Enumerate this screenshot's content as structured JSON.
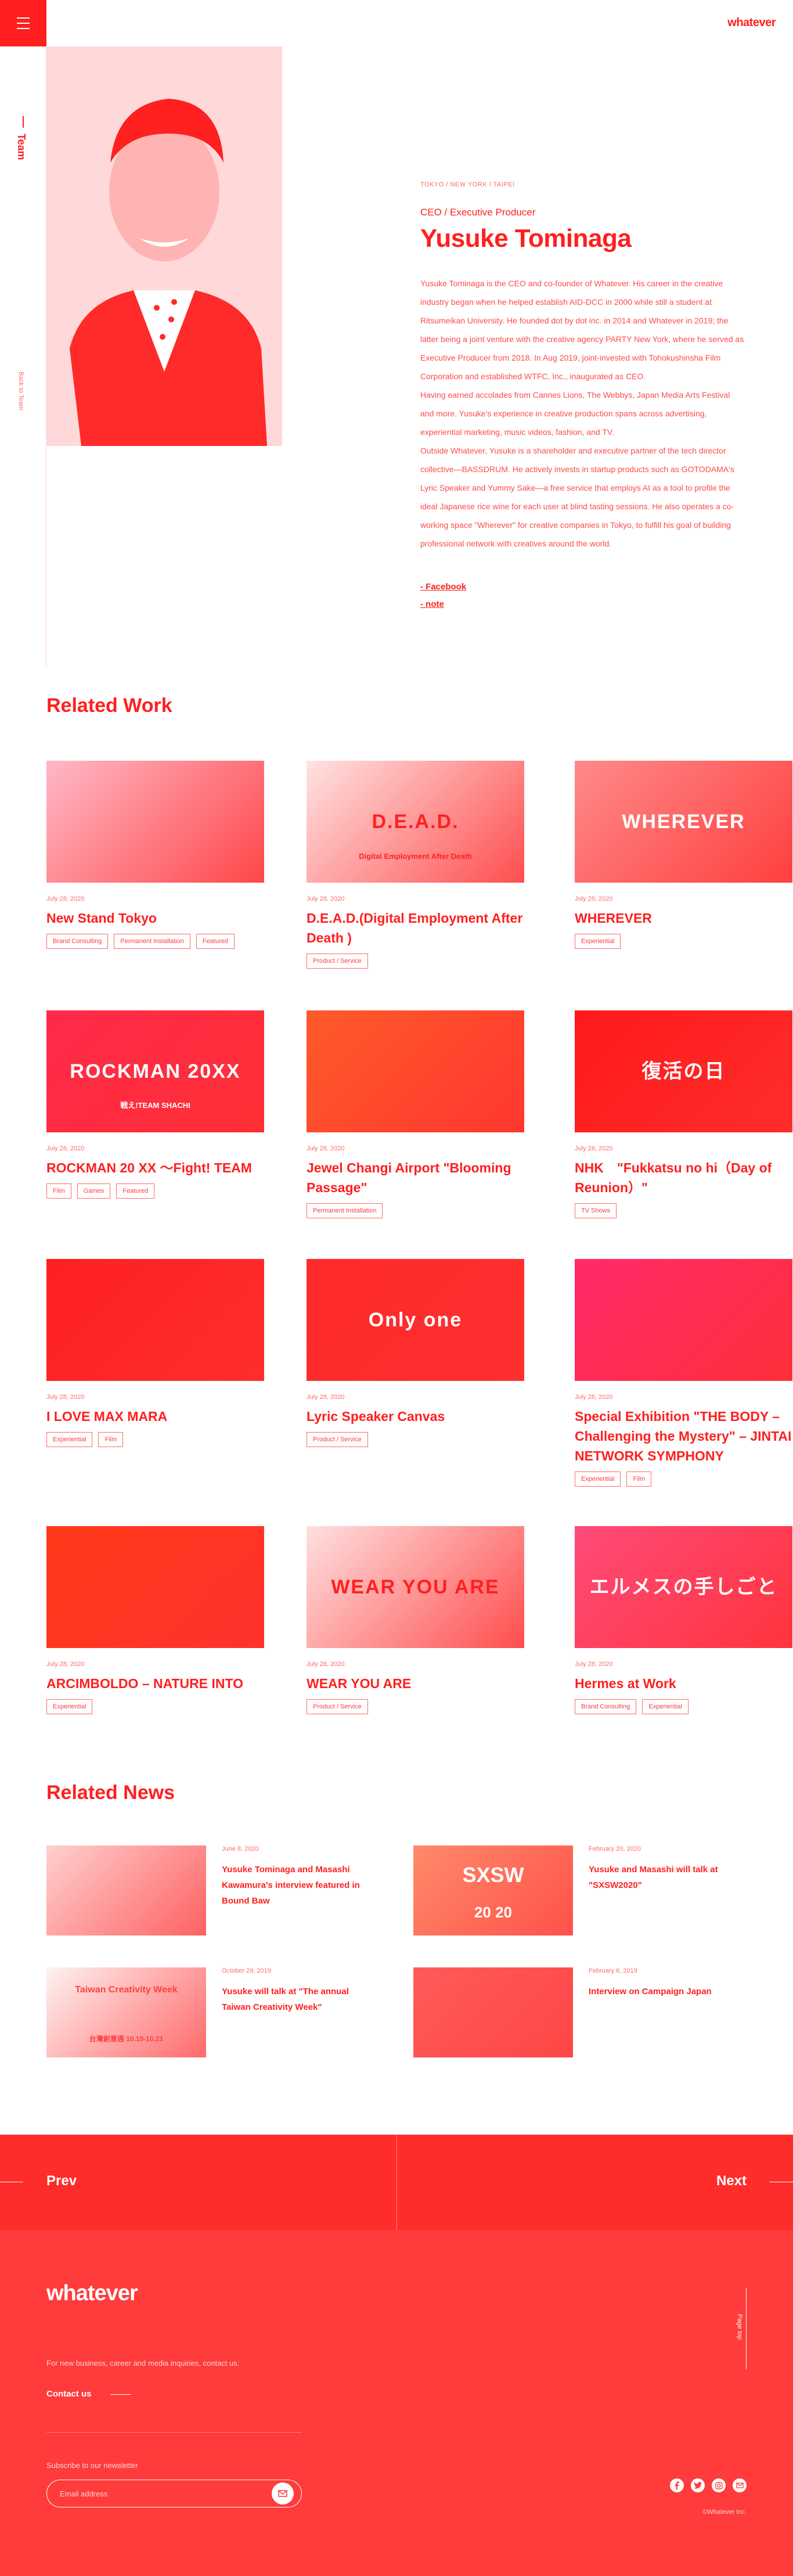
{
  "header": {
    "logo": "whatever",
    "menu_icon": "hamburger-icon"
  },
  "sidebar": {
    "label": "Team",
    "back_label": "Back to Team"
  },
  "profile": {
    "location": "TOKYO / NEW YORK / TAIPEI",
    "role": "CEO / Executive Producer",
    "name": "Yusuke Tominaga",
    "bio": [
      "Yusuke Tominaga is the CEO and co-founder of Whatever. His career in the creative industry began when he helped establish AID-DCC in 2000 while still a student at Ritsumeikan University. He founded dot by dot inc. in 2014 and Whatever in 2019; the latter being a joint venture with the creative agency PARTY New York, where he served as Executive Producer from 2018. In Aug 2019, joint-invested with Tohokushinsha Film Corporation and established WTFC, Inc., inaugurated as CEO.",
      "Having earned accolades from Cannes Lions, The Webbys, Japan Media Arts Festival and more. Yusuke's experience in creative production spans across advertising, experiential marketing, music videos, fashion, and TV.",
      "Outside Whatever, Yusuke is a shareholder and executive partner of the tech director collective—BASSDRUM. He actively invests in startup products such as GOTODAMA's Lyric Speaker and Yummy Sake—a free service that employs AI as a tool to profile the ideal Japanese rice wine for each user at blind tasting sessions. He also operates a co-working space \"Wherever\" for creative companies in Tokyo, to fulfill his goal of building professional network with creatives around the world."
    ],
    "links": [
      "- Facebook",
      "- note"
    ]
  },
  "related_work": {
    "heading": "Related Work",
    "items": [
      {
        "date": "July 28, 2020",
        "title": "New Stand Tokyo",
        "tags": [
          "Brand Consulting",
          "Permanent Installation",
          "Featured"
        ],
        "art": "",
        "color": "#ffb8c6"
      },
      {
        "date": "July 28, 2020",
        "title": "D.E.A.D.(Digital Employment After Death )",
        "tags": [
          "Product / Service"
        ],
        "art": "D.E.A.D.",
        "art_sub": "Digital Employment After Death",
        "color": "#ffe3e3"
      },
      {
        "date": "July 28, 2020",
        "title": "WHEREVER",
        "tags": [
          "Experiential"
        ],
        "art": "WHEREVER",
        "color": "#ff8a8a"
      },
      {
        "date": "July 28, 2020",
        "title": "ROCKMAN 20 XX 〜Fight! TEAM",
        "tags": [
          "Film",
          "Games",
          "Featured"
        ],
        "art": "ROCKMAN 20XX",
        "art_sub": "戦え!TEAM SHACHI",
        "color": "#ff2a4a"
      },
      {
        "date": "July 28, 2020",
        "title": "Jewel Changi Airport \"Blooming Passage\"",
        "tags": [
          "Permanent Installation"
        ],
        "art": "",
        "color": "#ff5a2a"
      },
      {
        "date": "July 28, 2020",
        "title": "NHK　\"Fukkatsu no hi（Day of Reunion）\"",
        "tags": [
          "TV Shows"
        ],
        "art": "復活の日",
        "color": "#ff1a1a"
      },
      {
        "date": "July 28, 2020",
        "title": "I LOVE MAX MARA",
        "tags": [
          "Experiential",
          "Film"
        ],
        "art": "",
        "color": "#ff2020"
      },
      {
        "date": "July 28, 2020",
        "title": "Lyric Speaker Canvas",
        "tags": [
          "Product / Service"
        ],
        "art": "Only one",
        "color": "#ff2a2a"
      },
      {
        "date": "July 28, 2020",
        "title": "Special Exhibition \"THE BODY – Challenging the Mystery\" – JINTAI NETWORK SYMPHONY",
        "tags": [
          "Experiential",
          "Film"
        ],
        "art": "",
        "color": "#ff2a6a"
      },
      {
        "date": "July 28, 2020",
        "title": "ARCIMBOLDO – NATURE INTO",
        "tags": [
          "Experiential"
        ],
        "art": "",
        "color": "#ff3a1a"
      },
      {
        "date": "July 28, 2020",
        "title": "WEAR YOU ARE",
        "tags": [
          "Product / Service"
        ],
        "art": "WEAR YOU ARE",
        "color": "#ffe0e0"
      },
      {
        "date": "July 28, 2020",
        "title": "Hermes at Work",
        "tags": [
          "Brand Consulting",
          "Experiential"
        ],
        "art": "エルメスの手しごと",
        "color": "#ff4a7a"
      }
    ]
  },
  "related_news": {
    "heading": "Related News",
    "items": [
      {
        "date": "June 8, 2020",
        "title": "Yusuke Tominaga and Masashi Kawamura's interview featured in Bound Baw",
        "art": "",
        "color": "#ffd0d0"
      },
      {
        "date": "February 20, 2020",
        "title": "Yusuke and Masashi will talk at \"SXSW2020\"",
        "art": "SXSW",
        "art_sub": "20 20",
        "color": "#ff8a6a"
      },
      {
        "date": "October 29, 2019",
        "title": "Yusuke will talk at \"The annual Taiwan Creativity Week\"",
        "art": "Taiwan Creativity Week",
        "art_sub": "台灣創意週 10.19-10.21",
        "color": "#fff2f2"
      },
      {
        "date": "February 6, 2019",
        "title": "Interview on Campaign Japan",
        "art": "",
        "color": "#ff5a5a"
      }
    ]
  },
  "pager": {
    "prev": "Prev",
    "next": "Next"
  },
  "footer": {
    "logo": "whatever",
    "message": "For new business, career and media inquiries, contact us.",
    "contact": "Contact us",
    "newsletter_label": "Subscribe to our newsletter",
    "email_placeholder": "Email address",
    "page_top": "Page top",
    "social": [
      "facebook-icon",
      "twitter-icon",
      "instagram-icon",
      "mail-icon"
    ],
    "copyright": "©Whatever Inc."
  },
  "colors": {
    "accent": "#ff1f1f",
    "footer": "#ff3b3b"
  }
}
